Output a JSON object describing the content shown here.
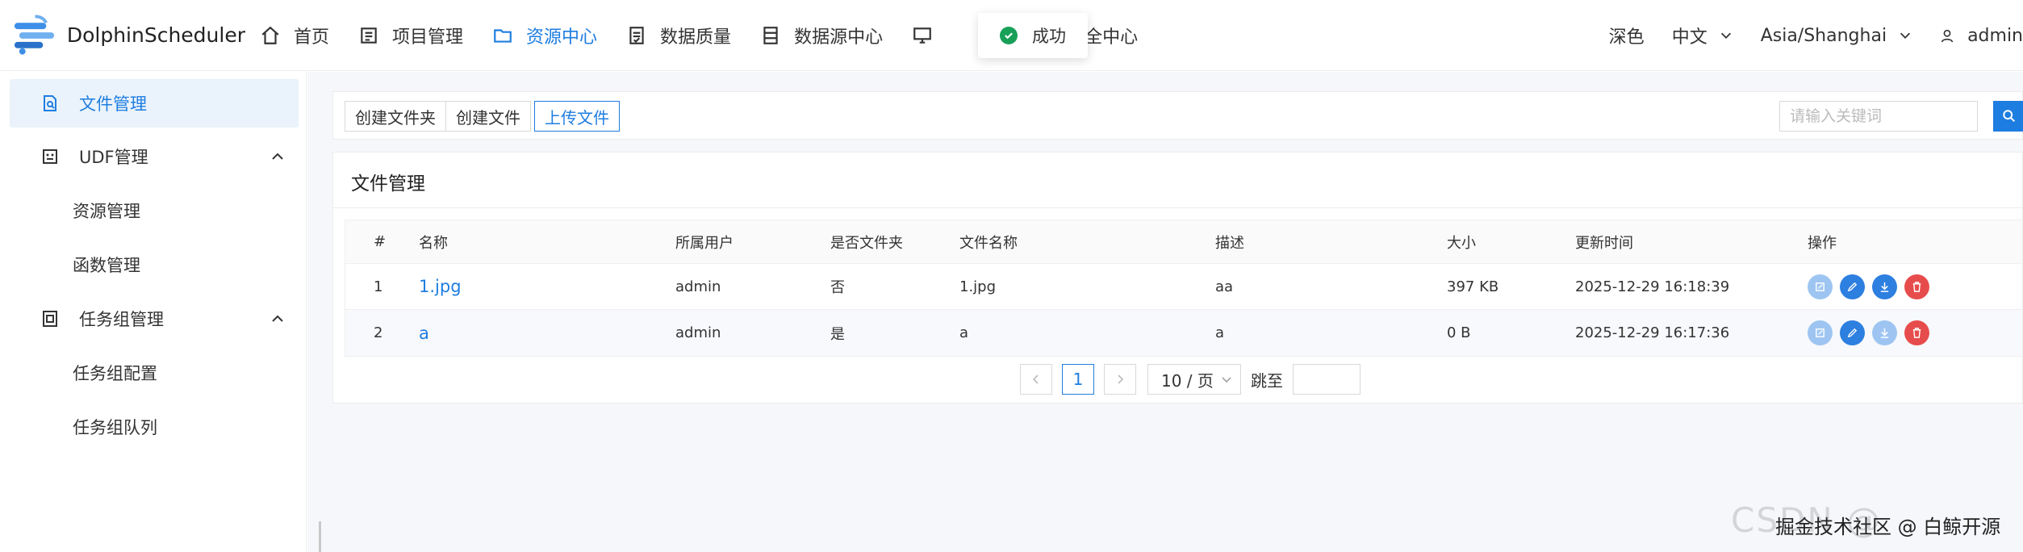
{
  "app": {
    "name": "DolphinScheduler"
  },
  "nav": {
    "items": [
      {
        "label": "首页",
        "icon": "home-icon"
      },
      {
        "label": "项目管理",
        "icon": "project-icon"
      },
      {
        "label": "资源中心",
        "icon": "folder-icon"
      },
      {
        "label": "数据质量",
        "icon": "quality-icon"
      },
      {
        "label": "数据源中心",
        "icon": "datasource-icon"
      },
      {
        "label": "",
        "icon": "monitor-icon"
      },
      {
        "label": "安全中心",
        "icon": "shield-icon"
      }
    ],
    "active": "资源中心",
    "theme": "深色",
    "language": "中文",
    "timezone": "Asia/Shanghai",
    "user": "admin"
  },
  "toast": {
    "text": "成功"
  },
  "sidebar": {
    "items": [
      {
        "label": "文件管理"
      },
      {
        "label": "UDF管理"
      },
      {
        "label": "资源管理"
      },
      {
        "label": "函数管理"
      },
      {
        "label": "任务组管理"
      },
      {
        "label": "任务组配置"
      },
      {
        "label": "任务组队列"
      }
    ]
  },
  "toolbar": {
    "create_folder": "创建文件夹",
    "create_file": "创建文件",
    "upload_file": "上传文件",
    "search_placeholder": "请输入关键词"
  },
  "card": {
    "title": "文件管理"
  },
  "table": {
    "columns": [
      "#",
      "名称",
      "所属用户",
      "是否文件夹",
      "文件名称",
      "描述",
      "大小",
      "更新时间",
      "操作"
    ],
    "rows": [
      {
        "index": "1",
        "name": "1.jpg",
        "user": "admin",
        "is_dir": "否",
        "file_name": "1.jpg",
        "desc": "aa",
        "size": "397 KB",
        "updated": "2025-12-29 16:18:39"
      },
      {
        "index": "2",
        "name": "a",
        "user": "admin",
        "is_dir": "是",
        "file_name": "a",
        "desc": "a",
        "size": "0 B",
        "updated": "2025-12-29 16:17:36"
      }
    ]
  },
  "pagination": {
    "current_page": "1",
    "page_size": "10 / 页",
    "jump_label": "跳至"
  },
  "watermark": {
    "text": "CSDN @ ",
    "overlay": "掘金技术社区 @ 白鲸开源"
  },
  "colors": {
    "accent": "#1e7de0",
    "danger": "#e74c4c",
    "success": "#18a058"
  }
}
